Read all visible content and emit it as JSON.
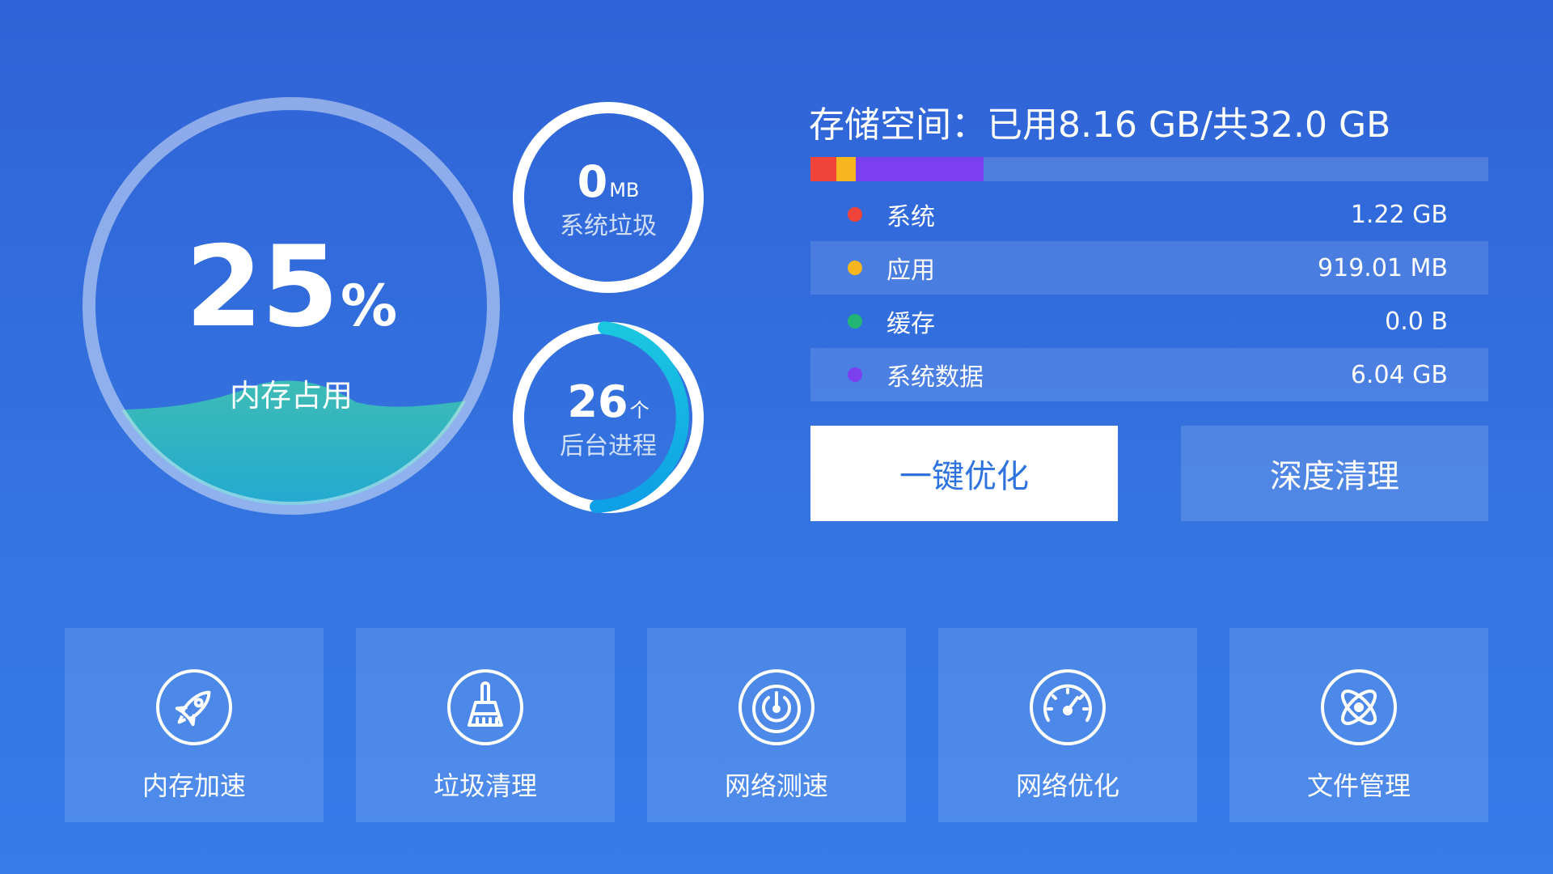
{
  "memory": {
    "value": "25",
    "unit": "%",
    "label": "内存占用",
    "usage_percent": 25
  },
  "junk": {
    "value": "0",
    "unit": "MB",
    "label": "系统垃圾"
  },
  "processes": {
    "value": "26",
    "unit": "个",
    "label": "后台进程"
  },
  "storage": {
    "title": "存储空间：已用8.16 GB/共32.0 GB",
    "used_gb": 8.16,
    "total_gb": 32.0,
    "items": [
      {
        "label": "系统",
        "value": "1.22 GB",
        "gb": 1.22,
        "color": "#f0443a"
      },
      {
        "label": "应用",
        "value": "919.01 MB",
        "gb": 0.9,
        "color": "#f7b51e"
      },
      {
        "label": "缓存",
        "value": "0.0 B",
        "gb": 0,
        "color": "#22b573"
      },
      {
        "label": "系统数据",
        "value": "6.04 GB",
        "gb": 6.04,
        "color": "#7b3fef"
      }
    ]
  },
  "buttons": {
    "optimize": "一键优化",
    "deep_clean": "深度清理"
  },
  "tools": [
    {
      "label": "内存加速",
      "icon": "rocket-icon"
    },
    {
      "label": "垃圾清理",
      "icon": "broom-icon"
    },
    {
      "label": "网络测速",
      "icon": "radar-icon"
    },
    {
      "label": "网络优化",
      "icon": "speedometer-icon"
    },
    {
      "label": "文件管理",
      "icon": "atom-icon"
    }
  ],
  "colors": {
    "accent": "#2f73de",
    "wave": "#2bb7b3",
    "process_ring": "#12b6e6"
  }
}
